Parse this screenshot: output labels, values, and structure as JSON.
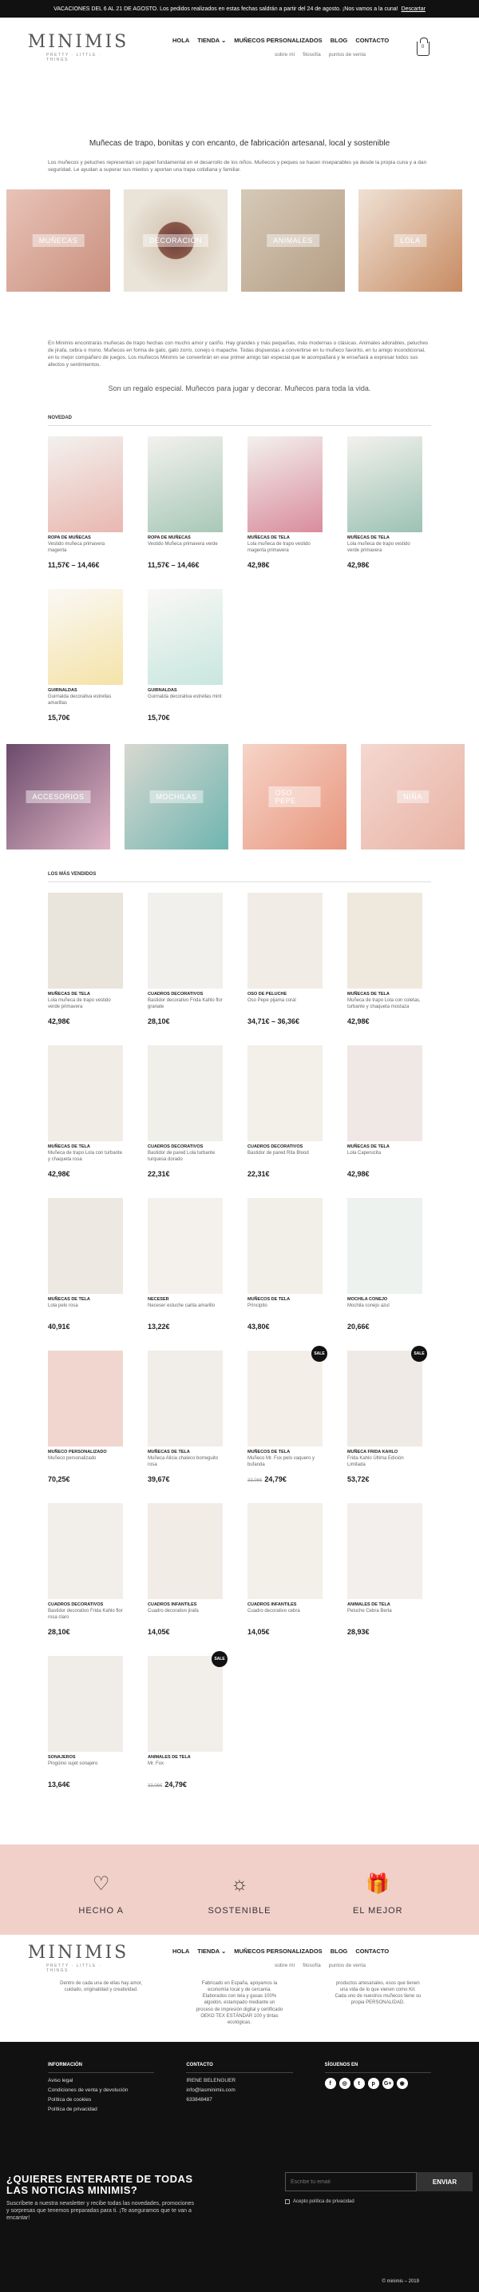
{
  "topbar": {
    "text": "VACACIONES DEL 6 AL 21 DE AGOSTO. Los pedidos realizados en estas fechas saldrán a partir del 24 de agosto. ¡Nos vamos a la cuna!",
    "dismiss": "Descartar"
  },
  "logo": {
    "name": "MINIMIS",
    "tagline": "PRETTY · LITTLE · THINGS"
  },
  "nav": {
    "items": [
      "HOLA",
      "TIENDA ⌄",
      "MUÑECOS PERSONALIZADOS",
      "BLOG",
      "CONTACTO"
    ],
    "sub": [
      "sobre mí",
      "filosofía",
      "puntos de venta"
    ],
    "cart_count": "0"
  },
  "hero": {
    "title": "Muñecas de trapo, bonitas y con encanto, de fabricación artesanal, local y sostenible",
    "text": "Los muñecos y peluches representan un papel fundamental en el desarrollo de los niños. Muñecos y peques se hacen inseparables ya desde la propia cuna y a dan seguridad. Le ayudan a superar sus miedos y aportan una trapa cotidiana y familiar."
  },
  "categories": [
    "MUÑECAS",
    "DECORACIÓN",
    "ANIMALES",
    "LOLA"
  ],
  "intro": {
    "text": "En Minimis encontrarás muñecas de trapo hechas con mucho amor y cariño. Hay grandes y más pequeñas, más modernas o clásicas. Animales adorables, peluches de jirafa, cebra o mono. Muñecos en forma de gato, gato zorro, conejo o mapache. Todas dispuestas a convertirse en tu muñeco favorito, en tu amigo incondicional, en tu mejor compañero de juegos. Los muñecos Minimis se convertirán en ese primer amigo tan especial que le acompañará y le enseñará a expresar todos sus afectos y sentimientos.",
    "tagline": "Son un regalo especial. Muñecos para jugar y decorar. Muñecos para toda la vida."
  },
  "novedad": {
    "title": "NOVEDAD",
    "products": [
      {
        "cat": "ROPA DE MUÑECAS",
        "name": "Vestido muñeca primavera magenta",
        "price": "11,57€ – 14,46€"
      },
      {
        "cat": "ROPA DE MUÑECAS",
        "name": "Vestido Muñeca primavera verde",
        "price": "11,57€ – 14,46€"
      },
      {
        "cat": "MUÑECAS DE TELA",
        "name": "Lola muñeca de trapo vestido magenta primavera",
        "price": "42,98€"
      },
      {
        "cat": "MUÑECAS DE TELA",
        "name": "Lola muñeca de trapo vestido verde primavera",
        "price": "42,98€"
      },
      {
        "cat": "GUIRNALDAS",
        "name": "Guirnalda decorativa estrellas amarillas",
        "price": "15,70€"
      },
      {
        "cat": "GUIRNALDAS",
        "name": "Guirnalda decorativa estrellas mint",
        "price": "15,70€"
      }
    ]
  },
  "categories2": [
    "ACCESORIOS",
    "MOCHILAS",
    "OSO PEPE",
    "NIÑA"
  ],
  "best": {
    "title": "LOS MÁS VENDIDOS",
    "products": [
      {
        "cat": "MUÑECAS DE TELA",
        "name": "Lola muñeca de trapo vestido verde primavera",
        "price": "42,98€",
        "old": ""
      },
      {
        "cat": "CUADROS DECORATIVOS",
        "name": "Bastidor decorativo Frida Kahlo flor granate",
        "price": "28,10€",
        "old": ""
      },
      {
        "cat": "OSO DE PELUCHE",
        "name": "Oso Pepe pijama coral",
        "price": "34,71€ – 36,36€",
        "old": ""
      },
      {
        "cat": "MUÑECAS DE TELA",
        "name": "Muñeca de trapo Lola con coletas, turbante y chaqueta mostaza",
        "price": "42,98€",
        "old": ""
      },
      {
        "cat": "MUÑECAS DE TELA",
        "name": "Muñeca de trapo Lola con turbante y chaqueta rosa",
        "price": "42,98€",
        "old": ""
      },
      {
        "cat": "CUADROS DECORATIVOS",
        "name": "Bastidor de pared Lola turbante turquesa dorado",
        "price": "22,31€",
        "old": ""
      },
      {
        "cat": "CUADROS DECORATIVOS",
        "name": "Bastidor de pared Rita Blood",
        "price": "22,31€",
        "old": ""
      },
      {
        "cat": "MUÑECAS DE TELA",
        "name": "Lola Caperucita",
        "price": "42,98€",
        "old": ""
      },
      {
        "cat": "MUÑECAS DE TELA",
        "name": "Lola pelo rosa",
        "price": "40,91€",
        "old": ""
      },
      {
        "cat": "NECESER",
        "name": "Neceser estuche carita amarillo",
        "price": "13,22€",
        "old": ""
      },
      {
        "cat": "MUÑECOS DE TELA",
        "name": "Principito",
        "price": "43,80€",
        "old": ""
      },
      {
        "cat": "MOCHILA CONEJO",
        "name": "Mochila conejo azul",
        "price": "20,66€",
        "old": ""
      },
      {
        "cat": "MUÑECO PERSONALIZADO",
        "name": "Muñeco personalizado",
        "price": "70,25€",
        "old": ""
      },
      {
        "cat": "MUÑECAS DE TELA",
        "name": "Muñeca Alicia chaleco borreguito rosa",
        "price": "39,67€",
        "old": ""
      },
      {
        "cat": "MUÑECOS DE TELA",
        "name": "Muñeco Mr. Fox pelo vaquero y bufanda",
        "price": "24,79€",
        "old": "33,06€",
        "badge": "SALE"
      },
      {
        "cat": "MUÑECA FRIDA KAHLO",
        "name": "Frida Kahlo Última Edición Limitada",
        "price": "53,72€",
        "old": "",
        "badge": "SALE"
      },
      {
        "cat": "CUADROS DECORATIVOS",
        "name": "Bastidor decorativo Frida Kahlo flor rosa claro",
        "price": "28,10€",
        "old": ""
      },
      {
        "cat": "CUADROS INFANTILES",
        "name": "Cuadro decorativo jirafa",
        "price": "14,05€",
        "old": ""
      },
      {
        "cat": "CUADROS INFANTILES",
        "name": "Cuadro decorativo cebra",
        "price": "14,05€",
        "old": ""
      },
      {
        "cat": "ANIMALES DE TELA",
        "name": "Peluche Cebra Berta",
        "price": "28,93€",
        "old": ""
      },
      {
        "cat": "SONAJEROS",
        "name": "Pingüino sujet sonajero",
        "price": "13,64€",
        "old": ""
      },
      {
        "cat": "ANIMALES DE TELA",
        "name": "Mr. Fox",
        "price": "24,79€",
        "old": "33,06€",
        "badge": "SALE"
      }
    ]
  },
  "features": [
    {
      "icon": "♡",
      "title": "HECHO A",
      "desc": "Dentro de cada una de ellas hay amor, cuidado, originalidad y creatividad."
    },
    {
      "icon": "☼",
      "title": "SOSTENIBLE",
      "desc": "Fabricado en España, apoyamos la economía local y de cercanía. Elaborados con tela y gasas 100% algodón, estampado mediante un proceso de impresión digital y certificado OEKO TEX ESTÁNDAR 100 y tintas ecológicas."
    },
    {
      "icon": "🎁",
      "title": "EL MEJOR",
      "desc": "productos artesanales, esos que tienen una vida de lo que vienen como Kit. Cada uno de nuestros muñecos tiene su propia PERSONALIDAD."
    }
  ],
  "footer": {
    "info_title": "INFORMACIÓN",
    "info_links": [
      "Aviso legal",
      "Condiciones de venta y devolución",
      "Política de cookies",
      "Política de privacidad"
    ],
    "contact_title": "CONTACTO",
    "contact": [
      "IRENE BELENGUER",
      "info@lasminimis.com",
      "633848487"
    ],
    "social_title": "SÍGUENOS EN",
    "social": [
      "f",
      "◎",
      "t",
      "p",
      "G+",
      "◉"
    ]
  },
  "newsletter": {
    "title": "¿QUIERES ENTERARTE DE TODAS LAS NOTICIAS MINIMIS?",
    "text": "Suscríbete a nuestra newsletter y recibe todas las novedades, promociones y sorpresas que tenemos preparadas para ti. ¡Te aseguramos que te van a encantar!",
    "placeholder": "Escribe tu email",
    "button": "ENVIAR",
    "checkbox": "Acepto política de privacidad",
    "copyright": "© minimis – 2019"
  },
  "colors": {
    "accent_pink": "#f2d0ca",
    "dark": "#111111"
  }
}
